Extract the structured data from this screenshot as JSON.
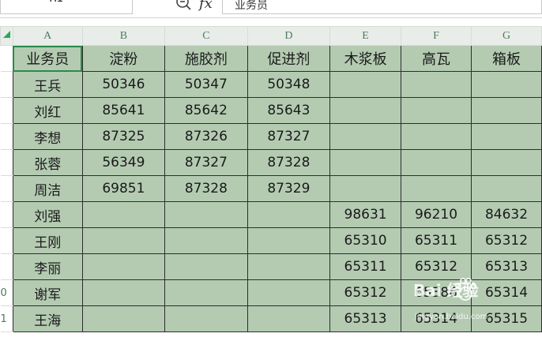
{
  "formula_bar": {
    "cell_ref": "A1",
    "formula": "业务员",
    "fx_label": "fx"
  },
  "columns": [
    "A",
    "B",
    "C",
    "D",
    "E",
    "F",
    "G"
  ],
  "row_numbers": [
    "",
    "",
    "",
    "",
    "",
    "",
    "",
    "",
    "",
    "0",
    "1"
  ],
  "rows": [
    [
      "业务员",
      "淀粉",
      "施胶剂",
      "促进剂",
      "木浆板",
      "高瓦",
      "箱板"
    ],
    [
      "王兵",
      "50346",
      "50347",
      "50348",
      "",
      "",
      ""
    ],
    [
      "刘红",
      "85641",
      "85642",
      "85643",
      "",
      "",
      ""
    ],
    [
      "李想",
      "87325",
      "87326",
      "87327",
      "",
      "",
      ""
    ],
    [
      "张蓉",
      "56349",
      "87327",
      "87328",
      "",
      "",
      ""
    ],
    [
      "周洁",
      "69851",
      "87328",
      "87329",
      "",
      "",
      ""
    ],
    [
      "刘强",
      "",
      "",
      "",
      "98631",
      "96210",
      "84632"
    ],
    [
      "王刚",
      "",
      "",
      "",
      "65310",
      "65311",
      "65312"
    ],
    [
      "李丽",
      "",
      "",
      "",
      "65311",
      "65312",
      "65313"
    ],
    [
      "谢军",
      "",
      "",
      "",
      "65312",
      "65386",
      "65314"
    ],
    [
      "王海",
      "",
      "",
      "",
      "65313",
      "65314",
      "65315"
    ]
  ],
  "watermark": {
    "text": "Bai 经验",
    "sub": "jingyan.baidu.com"
  },
  "colors": {
    "cell_fill": "#b4cbb2",
    "header_text": "#4f7a5f",
    "selection": "#2a8a4a"
  }
}
